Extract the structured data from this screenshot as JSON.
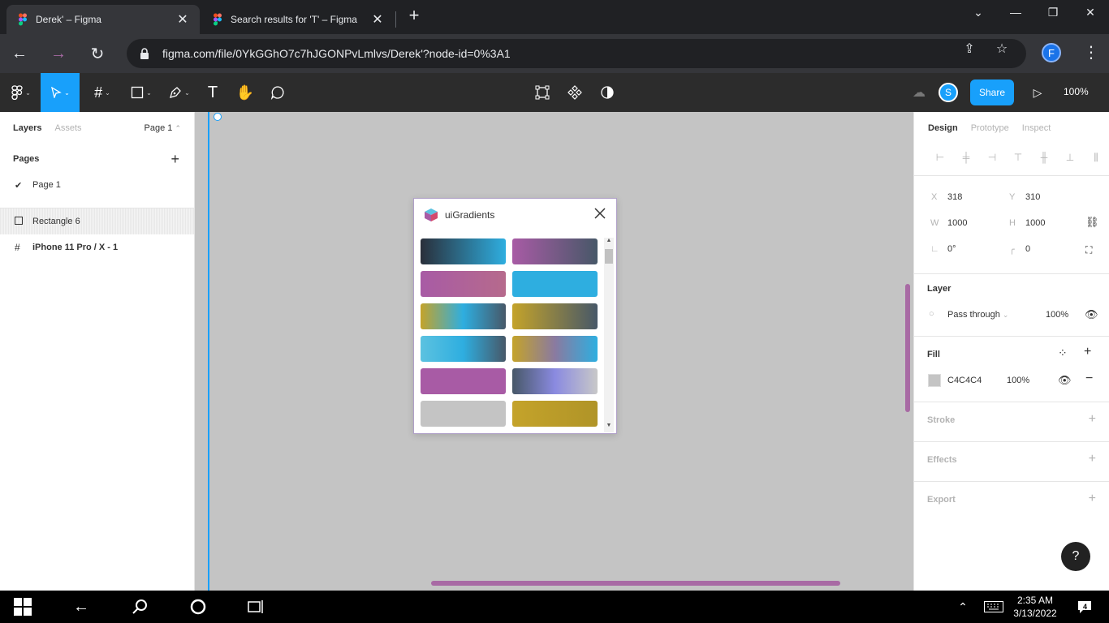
{
  "browser": {
    "tabs": [
      {
        "title": "Derek' – Figma",
        "active": true
      },
      {
        "title": "Search results for 'T' – Figma",
        "active": false
      }
    ],
    "url": "figma.com/file/0YkGGhO7c7hJGONPvLmlvs/Derek'?node-id=0%3A1",
    "profile_initial": "F"
  },
  "figma_toolbar": {
    "share_label": "Share",
    "avatar_initial": "S",
    "zoom": "100%"
  },
  "left_panel": {
    "tabs": {
      "layers": "Layers",
      "assets": "Assets"
    },
    "current_page": "Page 1",
    "pages_title": "Pages",
    "pages": [
      "Page 1"
    ],
    "layers": [
      {
        "name": "Rectangle 6",
        "icon": "rectangle-icon"
      },
      {
        "name": "iPhone 11 Pro / X - 1",
        "icon": "frame-icon"
      }
    ]
  },
  "plugin": {
    "title": "uiGradients",
    "swatches": [
      {
        "colors": [
          "#2a2f3a",
          "#2eaee0"
        ]
      },
      {
        "colors": [
          "#a85ba5",
          "#475868"
        ]
      },
      {
        "colors": [
          "#a85ba5",
          "#b66a8c"
        ]
      },
      {
        "colors": [
          "#2eaee0",
          "#2eaee0"
        ]
      },
      {
        "colors": [
          "#c4a32a",
          "#2eaee0",
          "#475868"
        ]
      },
      {
        "colors": [
          "#c4a32a",
          "#475868"
        ]
      },
      {
        "colors": [
          "#5cc2e0",
          "#2eaee0",
          "#475868"
        ]
      },
      {
        "colors": [
          "#c4a32a",
          "#8a7aa0",
          "#2eaee0"
        ]
      },
      {
        "colors": [
          "#a85ba5",
          "#a85ba5"
        ]
      },
      {
        "colors": [
          "#475868",
          "#8a8ae0",
          "#c8c8c8"
        ]
      },
      {
        "colors": [
          "#c4c4c4",
          "#c4c4c4"
        ]
      },
      {
        "colors": [
          "#c4a32a",
          "#b09428"
        ]
      }
    ]
  },
  "right_panel": {
    "tabs": {
      "design": "Design",
      "prototype": "Prototype",
      "inspect": "Inspect"
    },
    "x_label": "X",
    "x_value": "318",
    "y_label": "Y",
    "y_value": "310",
    "w_label": "W",
    "w_value": "1000",
    "h_label": "H",
    "h_value": "1000",
    "rotation": "0°",
    "radius": "0",
    "layer_title": "Layer",
    "blend_mode": "Pass through",
    "layer_opacity": "100%",
    "fill_title": "Fill",
    "fill_hex": "C4C4C4",
    "fill_opacity": "100%",
    "fill_color": "#c4c4c4",
    "stroke_title": "Stroke",
    "effects_title": "Effects",
    "export_title": "Export",
    "help": "?"
  },
  "taskbar": {
    "time": "2:35 AM",
    "date": "3/13/2022",
    "notification_count": "4"
  }
}
